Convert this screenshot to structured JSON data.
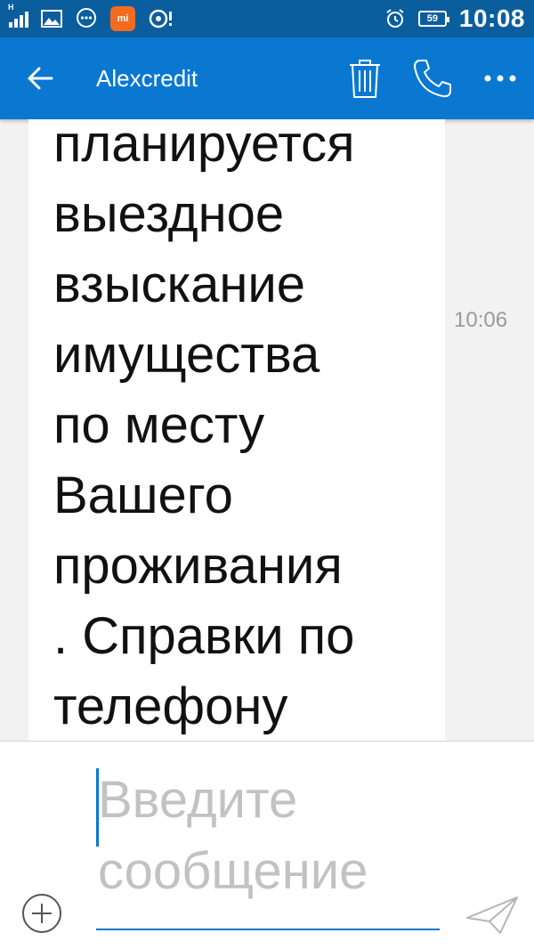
{
  "status_bar": {
    "network": "H",
    "battery": "59",
    "mi_label": "mi",
    "time": "10:08"
  },
  "toolbar": {
    "title": "Alexcredit",
    "icons": [
      "back-arrow-icon",
      "trash-icon",
      "phone-icon",
      "more-icon"
    ]
  },
  "message": {
    "text": "планируется\nвыездное\nвзыскание\nимущества\nпо месту\nВашего\nпроживания\n. Справки по\nтелефону",
    "time": "10:06"
  },
  "compose": {
    "placeholder": "Введите сообщение"
  },
  "colors": {
    "status_bar": "#0a5e9e",
    "toolbar": "#0a78d1",
    "accent": "#0a78d1"
  }
}
